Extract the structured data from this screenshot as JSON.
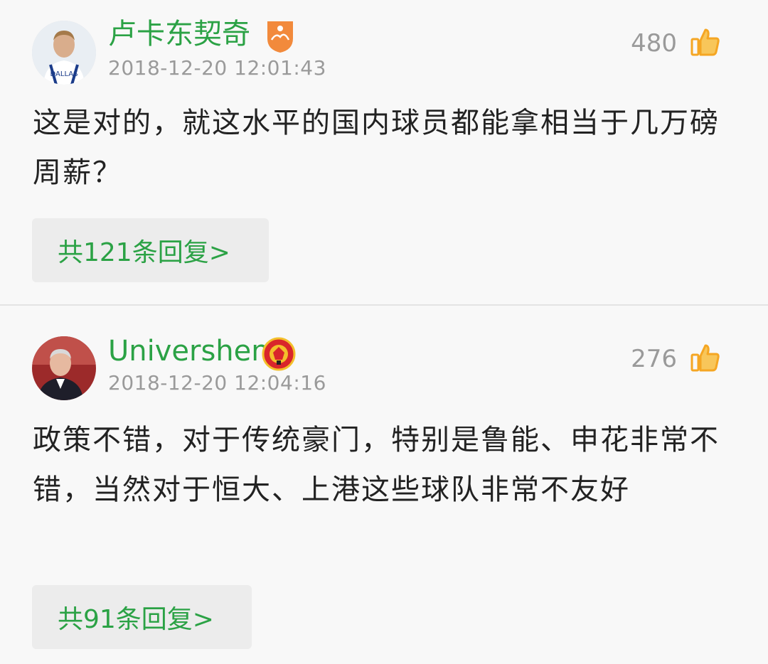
{
  "comments": [
    {
      "username": "卢卡东契奇",
      "badge_icon": "orange-team-badge-icon",
      "timestamp": "2018-12-20 12:01:43",
      "likes": "480",
      "content": "这是对的，就这水平的国内球员都能拿相当于几万磅周薪？",
      "reply_label": "共121条回复>"
    },
    {
      "username": "Univershen",
      "badge_icon": "manchester-united-crest-icon",
      "timestamp": "2018-12-20 12:04:16",
      "likes": "276",
      "content": "政策不错，对于传统豪门，特别是鲁能、申花非常不错，当然对于恒大、上港这些球队非常不友好",
      "reply_label": "共91条回复>"
    }
  ],
  "colors": {
    "username": "#2ba245",
    "meta": "#9a9a9a",
    "thumb": "#f5a623",
    "reply_bg": "#ececec",
    "background": "#f8f8f8"
  }
}
